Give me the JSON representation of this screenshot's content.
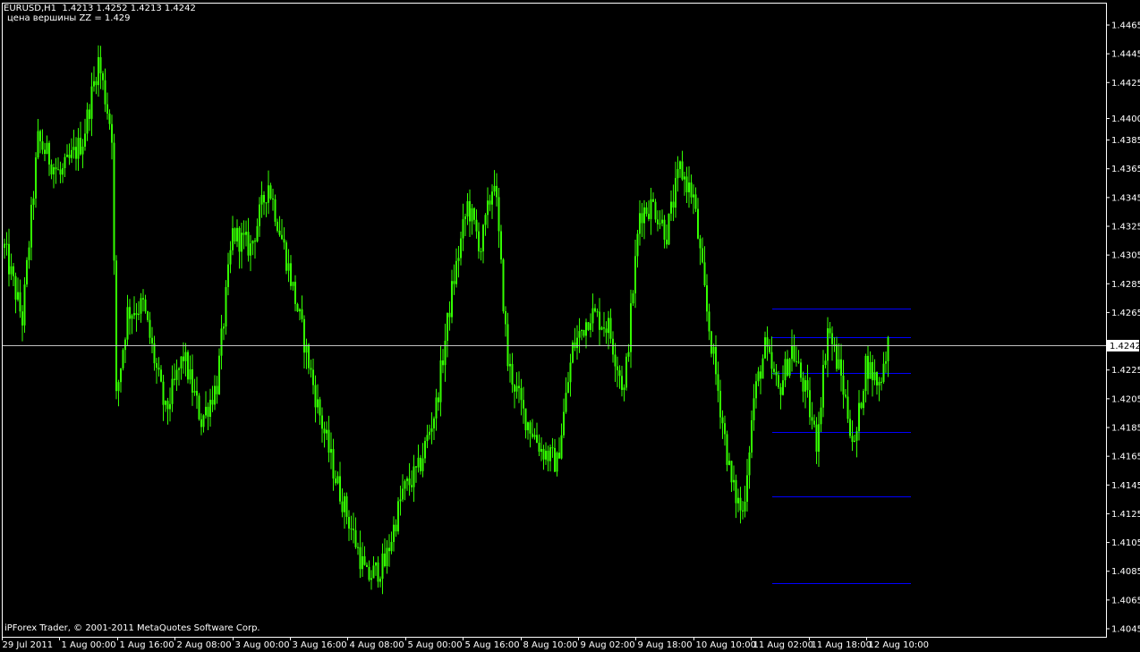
{
  "header": {
    "symbol": "EURUSD,H1",
    "ohlc": "1.4213 1.4252 1.4213 1.4242",
    "indicator_label": "цена вершины ZZ = 1.429"
  },
  "footer": {
    "copyright": "iPForex Trader, © 2001-2011 MetaQuotes Software Corp."
  },
  "colors": {
    "background": "#000000",
    "candle": "#33ff00",
    "frame": "#ffffff",
    "level_lines": "#0000ff",
    "current_price_line": "#c0c0c0",
    "price_box_bg": "#ffffff",
    "price_box_text": "#000000"
  },
  "chart_data": {
    "type": "candlestick",
    "symbol": "EURUSD",
    "timeframe": "H1",
    "current_price": "1.4242",
    "ylim": [
      1.4036,
      1.4482
    ],
    "y_ticks": [
      "1.4465",
      "1.4445",
      "1.4425",
      "1.4400",
      "1.4385",
      "1.4365",
      "1.4345",
      "1.4325",
      "1.4305",
      "1.4285",
      "1.4265",
      "1.4225",
      "1.4205",
      "1.4185",
      "1.4165",
      "1.4145",
      "1.4125",
      "1.4105",
      "1.4085",
      "1.4065",
      "1.4045"
    ],
    "x_ticks": [
      "29 Jul 2011",
      "1 Aug 00:00",
      "1 Aug 16:00",
      "2 Aug 08:00",
      "3 Aug 00:00",
      "3 Aug 16:00",
      "4 Aug 08:00",
      "5 Aug 00:00",
      "5 Aug 16:00",
      "8 Aug 10:00",
      "9 Aug 02:00",
      "9 Aug 18:00",
      "10 Aug 10:00",
      "11 Aug 02:00",
      "11 Aug 18:00",
      "12 Aug 10:00"
    ],
    "levels": [
      1.4268,
      1.4248,
      1.4223,
      1.4182,
      1.4137,
      1.4077
    ],
    "anchors": [
      [
        0,
        1.431
      ],
      [
        8,
        1.426
      ],
      [
        15,
        1.4385
      ],
      [
        25,
        1.436
      ],
      [
        35,
        1.4385
      ],
      [
        42,
        1.444
      ],
      [
        48,
        1.439
      ],
      [
        50,
        1.4205
      ],
      [
        55,
        1.4265
      ],
      [
        62,
        1.427
      ],
      [
        72,
        1.4195
      ],
      [
        80,
        1.4235
      ],
      [
        88,
        1.419
      ],
      [
        95,
        1.4215
      ],
      [
        102,
        1.432
      ],
      [
        110,
        1.431
      ],
      [
        118,
        1.4355
      ],
      [
        125,
        1.431
      ],
      [
        132,
        1.426
      ],
      [
        140,
        1.42
      ],
      [
        148,
        1.415
      ],
      [
        155,
        1.4115
      ],
      [
        162,
        1.408
      ],
      [
        170,
        1.409
      ],
      [
        178,
        1.414
      ],
      [
        185,
        1.4155
      ],
      [
        193,
        1.42
      ],
      [
        200,
        1.428
      ],
      [
        207,
        1.434
      ],
      [
        213,
        1.431
      ],
      [
        219,
        1.436
      ],
      [
        225,
        1.423
      ],
      [
        232,
        1.4195
      ],
      [
        240,
        1.417
      ],
      [
        247,
        1.416
      ],
      [
        254,
        1.424
      ],
      [
        262,
        1.4265
      ],
      [
        270,
        1.4255
      ],
      [
        277,
        1.421
      ],
      [
        284,
        1.4335
      ],
      [
        290,
        1.434
      ],
      [
        296,
        1.432
      ],
      [
        302,
        1.4365
      ],
      [
        308,
        1.4345
      ],
      [
        314,
        1.4265
      ],
      [
        320,
        1.42
      ],
      [
        325,
        1.4145
      ],
      [
        330,
        1.4125
      ],
      [
        335,
        1.4205
      ],
      [
        340,
        1.424
      ],
      [
        346,
        1.421
      ],
      [
        352,
        1.424
      ],
      [
        358,
        1.421
      ],
      [
        363,
        1.4175
      ],
      [
        368,
        1.4255
      ],
      [
        374,
        1.422
      ],
      [
        380,
        1.417
      ],
      [
        385,
        1.423
      ],
      [
        391,
        1.4215
      ],
      [
        395,
        1.4245
      ]
    ]
  }
}
